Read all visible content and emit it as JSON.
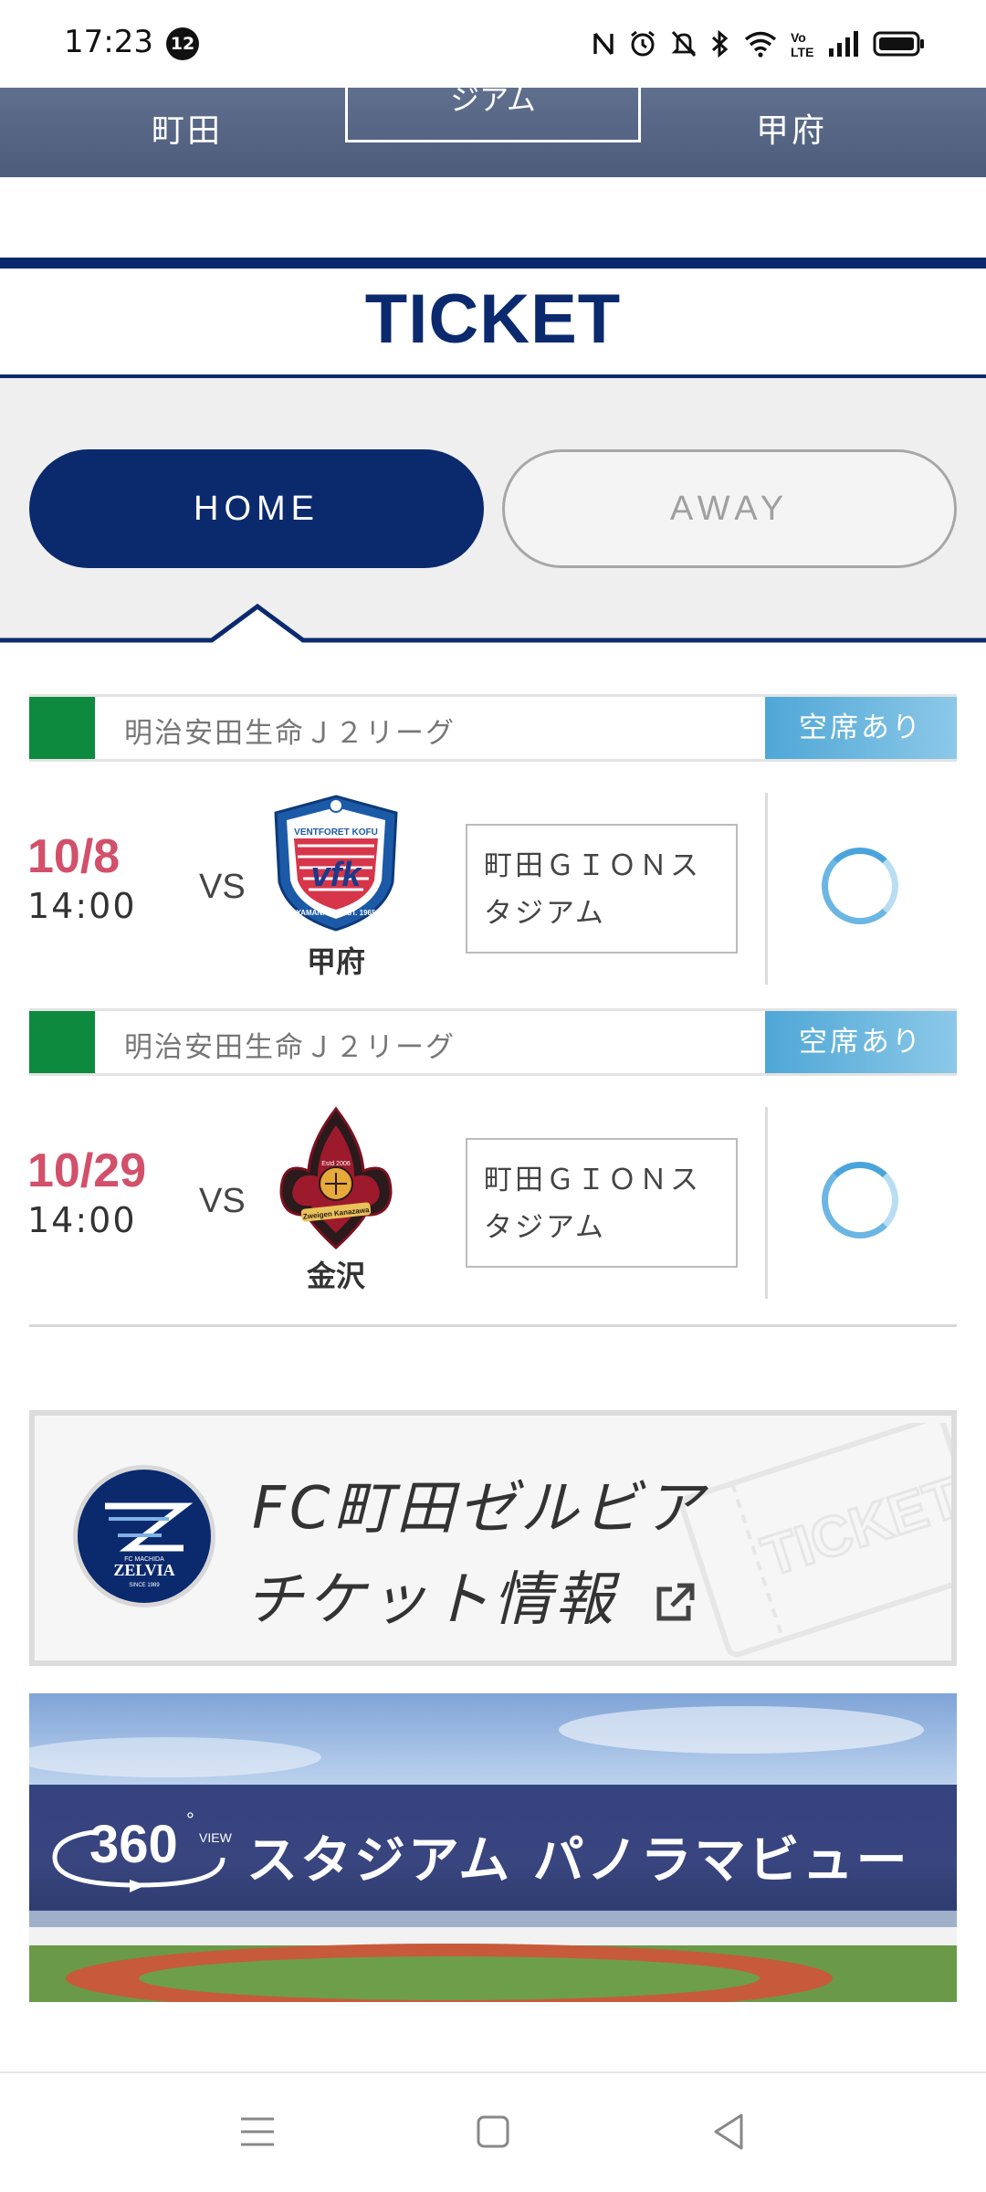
{
  "status_bar": {
    "time": "17:23",
    "notification_count": "12",
    "icons": [
      "nfc-icon",
      "alarm-icon",
      "mute-icon",
      "bluetooth-icon",
      "wifi-icon",
      "volte-icon",
      "signal-icon",
      "battery-icon"
    ]
  },
  "match_strip": {
    "home_team": "町田",
    "venue_partial": "ジアム",
    "away_team": "甲府"
  },
  "ticket": {
    "title": "TICKET",
    "tabs": [
      {
        "label": "HOME",
        "selected": true
      },
      {
        "label": "AWAY",
        "selected": false
      }
    ]
  },
  "matches": [
    {
      "league": "明治安田生命Ｊ２リーグ",
      "seat_status": "空席あり",
      "date": "10/8",
      "time": "14:00",
      "vs": "VS",
      "opponent": "甲府",
      "venue_line1": "町田ＧＩＯＮス",
      "venue_line2": "タジアム",
      "crest_text_top": "VENTFORET KOFU",
      "crest_text_bottom": "YAMANASHI EST. 1965",
      "crest_letters": "vfk"
    },
    {
      "league": "明治安田生命Ｊ２リーグ",
      "seat_status": "空席あり",
      "date": "10/29",
      "time": "14:00",
      "vs": "VS",
      "opponent": "金沢",
      "venue_line1": "町田ＧＩＯＮス",
      "venue_line2": "タジアム",
      "crest_text": "Zweigen Kanazawa",
      "crest_year": "Estd 2006"
    }
  ],
  "banners": {
    "ticket_info_line1": "FC町田ゼルビア",
    "ticket_info_line2": "チケット情報",
    "ticket_watermark": "TICKET",
    "logo_text": "ZELVIA",
    "logo_subtext": "FC MACHIDA",
    "logo_since": "SINCE 1989",
    "panorama_label": "スタジアム パノラマビュー",
    "panorama_360": "360",
    "panorama_view": "VIEW"
  },
  "colors": {
    "navy": "#0b2a6e",
    "date_red": "#d2506a",
    "league_green": "#0d8a3e",
    "seat_blue": "#4fa7d6"
  }
}
